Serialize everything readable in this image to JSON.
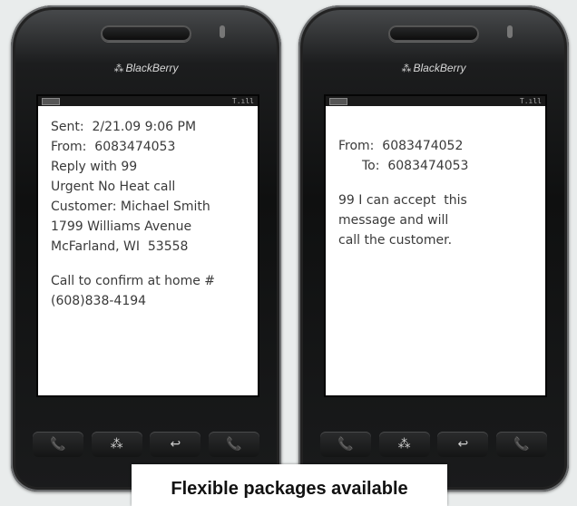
{
  "brand": {
    "logo": "⁂",
    "name": "BlackBerry"
  },
  "left_phone": {
    "lines": [
      "Sent:  2/21.09 9:06 PM",
      "From:  6083474053",
      "Reply with 99",
      "Urgent No Heat call",
      "Customer: Michael Smith",
      "1799 Williams Avenue",
      "McFarland, WI  53558",
      "",
      "Call to confirm at home #",
      "(608)838-4194"
    ]
  },
  "right_phone": {
    "from": "From:  6083474052",
    "to": "To:  6083474053",
    "reply_lines": [
      "99 I can accept  this",
      "message and will",
      "call the customer."
    ]
  },
  "keys": {
    "call": "📞",
    "menu": "⁂",
    "back": "↩",
    "end": "📞"
  },
  "banner": {
    "text": "Flexible packages available"
  }
}
